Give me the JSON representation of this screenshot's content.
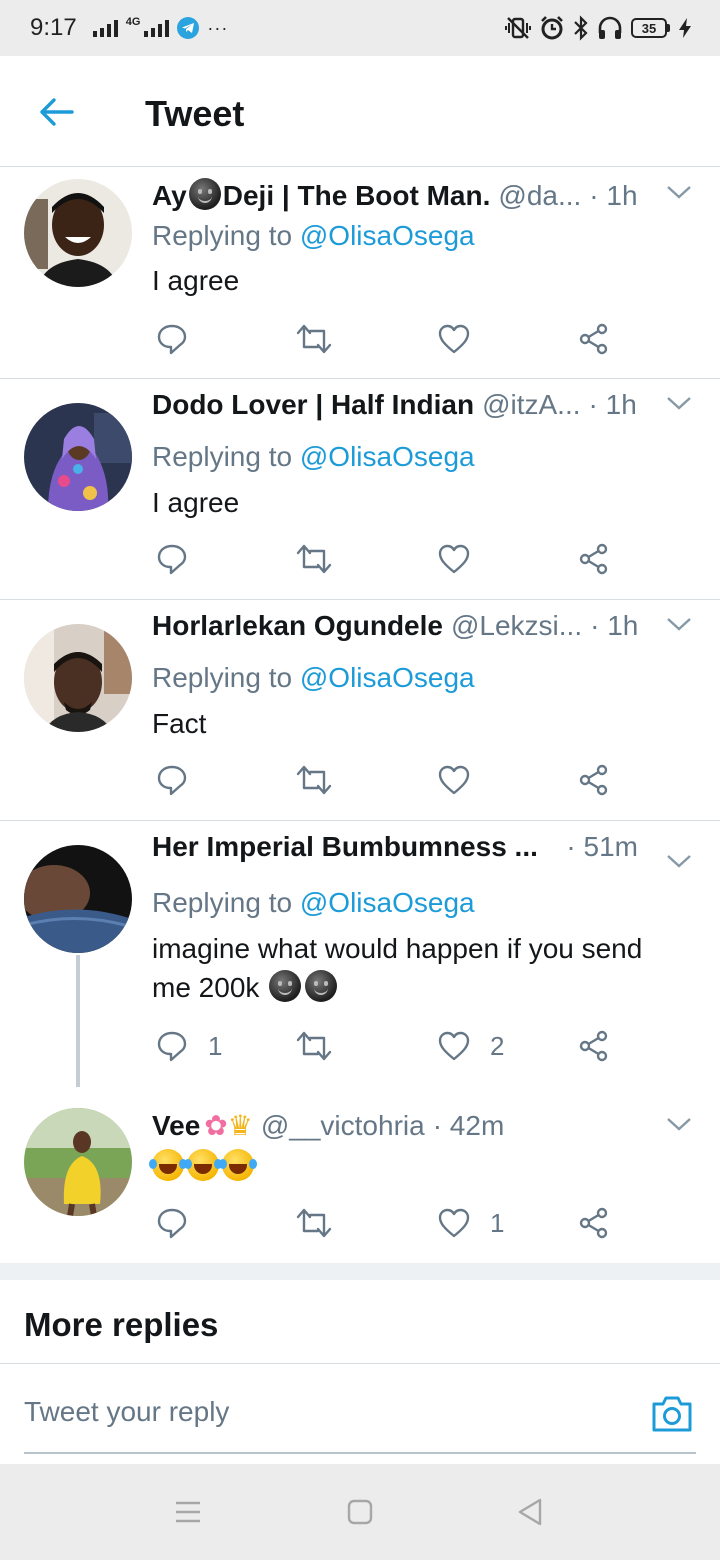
{
  "status_bar": {
    "time": "9:17",
    "network_label": "4G",
    "battery_level": "35",
    "icons": [
      "signal-icon",
      "mobile-data-icon",
      "telegram-icon",
      "more-dots-icon",
      "vibrate-icon",
      "alarm-icon",
      "bluetooth-icon",
      "headphones-icon",
      "battery-icon",
      "charging-icon"
    ]
  },
  "header": {
    "title": "Tweet"
  },
  "tweets": [
    {
      "name_before": "Ay",
      "name_after": "Deji | The Boot Man.",
      "handle": "@da...",
      "time": "· 1h",
      "replying_prefix": "Replying to",
      "replying_to": "@OlisaOsega",
      "text": "I agree",
      "reply_count": "",
      "like_count": ""
    },
    {
      "name": "Dodo Lover | Half Indian",
      "handle": "@itzA...",
      "time": "· 1h",
      "replying_prefix": "Replying to",
      "replying_to": "@OlisaOsega",
      "text": "I agree",
      "reply_count": "",
      "like_count": ""
    },
    {
      "name": "Horlarlekan Ogundele",
      "handle": "@Lekzsi...",
      "time": "· 1h",
      "replying_prefix": "Replying to",
      "replying_to": "@OlisaOsega",
      "text": "Fact",
      "reply_count": "",
      "like_count": ""
    },
    {
      "name": "Her Imperial Bumbumness ...",
      "handle": "",
      "time": "· 51m",
      "replying_prefix": "Replying to",
      "replying_to": "@OlisaOsega",
      "text_line1": "imagine what would happen if you send",
      "text_line2": "me 200k",
      "reply_count": "1",
      "like_count": "2"
    },
    {
      "name": "Vee",
      "handle": "@__victohria",
      "time": "· 42m",
      "reply_count": "",
      "like_count": "1"
    }
  ],
  "more_replies": {
    "label": "More replies"
  },
  "reply_box": {
    "placeholder": "Tweet your reply"
  },
  "colors": {
    "accent": "#1d9bd9",
    "muted": "#657786",
    "divider": "#d8dde1"
  }
}
